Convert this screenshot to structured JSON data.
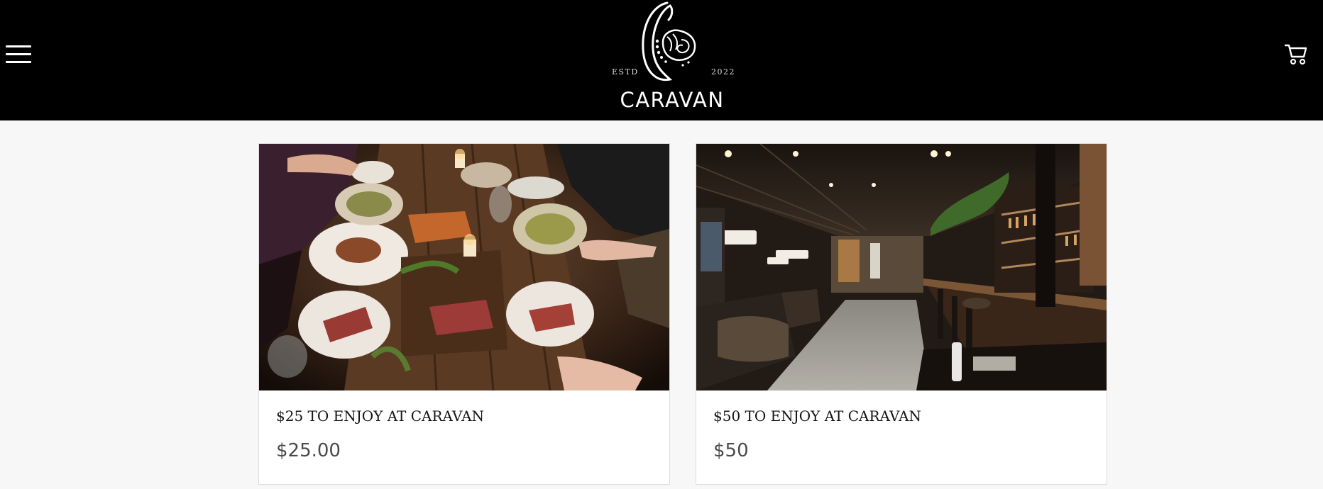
{
  "header": {
    "brand": {
      "name": "CARAVAN",
      "estd_label": "ESTD",
      "year": "2022"
    },
    "menu_icon": "hamburger-menu-icon",
    "cart_icon": "shopping-cart-icon",
    "background_color": "#000000"
  },
  "products": [
    {
      "title": "$25 TO ENJOY AT CARAVAN",
      "price": "$25.00",
      "image": "restaurant-dinner-table-photo"
    },
    {
      "title": "$50 TO ENJOY AT CARAVAN",
      "price": "$50",
      "image": "restaurant-interior-bar-photo"
    }
  ]
}
